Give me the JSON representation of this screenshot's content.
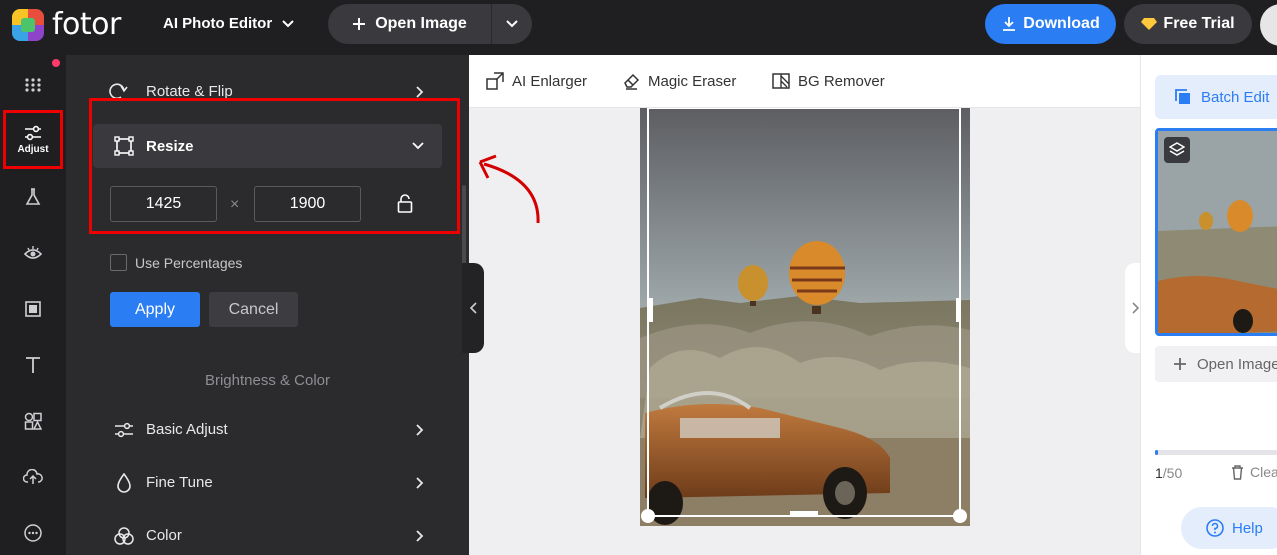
{
  "app": {
    "logo_text": "fotor",
    "product": "AI Photo Editor",
    "open_image": "Open Image",
    "download": "Download",
    "free_trial": "Free Trial",
    "brand_color": "#2b7df4"
  },
  "rail": {
    "adjust_label": "Adjust"
  },
  "panel": {
    "rotate_flip": "Rotate & Flip",
    "resize": "Resize",
    "width": "1425",
    "height": "1900",
    "times": "×",
    "use_percentages": "Use Percentages",
    "apply": "Apply",
    "cancel": "Cancel",
    "section_brightness": "Brightness & Color",
    "basic_adjust": "Basic Adjust",
    "fine_tune": "Fine Tune",
    "color": "Color"
  },
  "toolbar": {
    "ai_enlarger": "AI Enlarger",
    "magic_eraser": "Magic Eraser",
    "bg_remover": "BG Remover"
  },
  "right": {
    "batch_edit": "Batch Edit",
    "open_image": "Open Image",
    "count_current": "1",
    "count_total": "/50",
    "clear": "Clear",
    "help": "Help",
    "progress_fraction": 0.02
  }
}
